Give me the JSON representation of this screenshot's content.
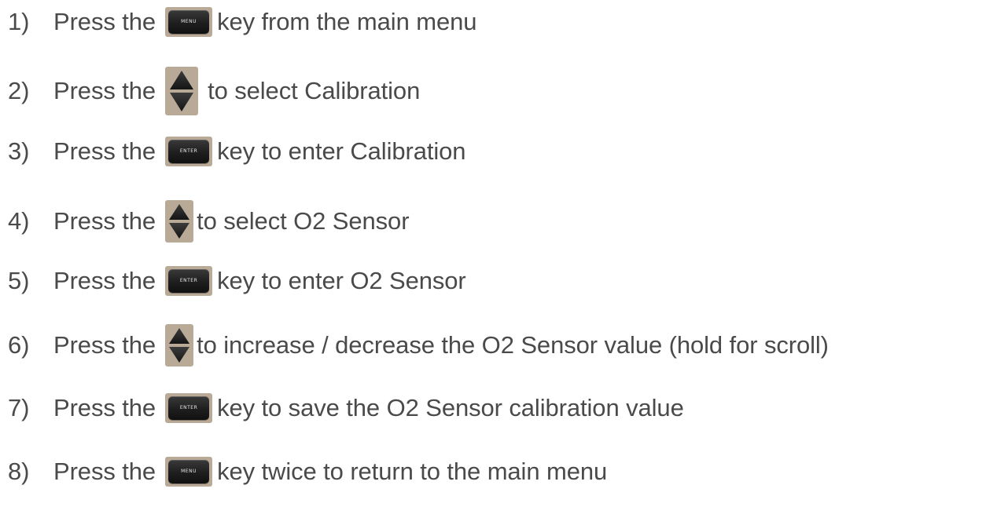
{
  "steps": [
    {
      "number": "1)",
      "lead": "Press the",
      "key": "MENU",
      "key_icon": "menu-key-icon",
      "text": "key from the main menu"
    },
    {
      "number": "2)",
      "lead": "Press the",
      "key": "",
      "key_icon": "up-down-arrow-key-icon",
      "text": "to select Calibration"
    },
    {
      "number": "3)",
      "lead": "Press the",
      "key": "ENTER",
      "key_icon": "enter-key-icon",
      "text": "key to enter Calibration"
    },
    {
      "number": "4)",
      "lead": "Press the",
      "key": "",
      "key_icon": "up-down-arrow-key-icon",
      "text": "to select O2 Sensor"
    },
    {
      "number": "5)",
      "lead": "Press the",
      "key": "ENTER",
      "key_icon": "enter-key-icon",
      "text": "key to enter O2 Sensor"
    },
    {
      "number": "6)",
      "lead": "Press the",
      "key": "",
      "key_icon": "up-down-arrow-key-icon",
      "text": "to increase / decrease the O2 Sensor value (hold for scroll)"
    },
    {
      "number": "7)",
      "lead": "Press the",
      "key": "ENTER",
      "key_icon": "enter-key-icon",
      "text": "key to save the O2 Sensor calibration value"
    },
    {
      "number": "8)",
      "lead": "Press the",
      "key": "MENU",
      "key_icon": "menu-key-icon",
      "text": "key twice to return to the main menu"
    }
  ],
  "colors": {
    "text": "#4a4a4a",
    "key_background": "#b9aa98",
    "key_cap": "#1e1e1e",
    "key_label": "#e6e6e6"
  }
}
